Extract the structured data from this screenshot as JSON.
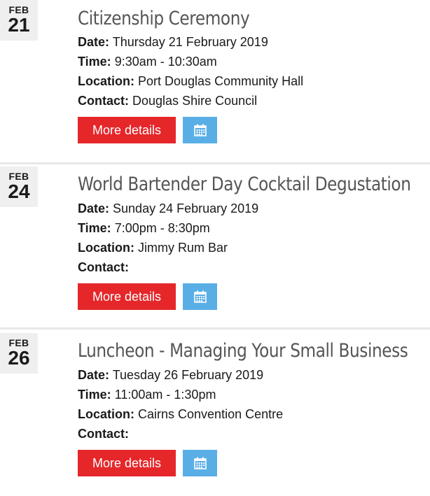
{
  "events": [
    {
      "month": "FEB",
      "day": "21",
      "title": "Citizenship Ceremony",
      "date_label": "Date:",
      "date_value": "Thursday 21 February 2019",
      "time_label": "Time:",
      "time_value": "9:30am - 10:30am",
      "location_label": "Location:",
      "location_value": "Port Douglas Community Hall",
      "contact_label": "Contact:",
      "contact_value": "Douglas Shire Council",
      "button_label": "More details",
      "calendar_icon": "calendar-icon"
    },
    {
      "month": "FEB",
      "day": "24",
      "title": "World Bartender Day Cocktail Degustation",
      "date_label": "Date:",
      "date_value": "Sunday 24 February 2019",
      "time_label": "Time:",
      "time_value": "7:00pm - 8:30pm",
      "location_label": "Location:",
      "location_value": "Jimmy Rum Bar",
      "contact_label": "Contact:",
      "contact_value": "",
      "button_label": "More details",
      "calendar_icon": "calendar-icon"
    },
    {
      "month": "FEB",
      "day": "26",
      "title": "Luncheon - Managing Your Small Business",
      "date_label": "Date:",
      "date_value": "Tuesday 26 February 2019",
      "time_label": "Time:",
      "time_value": "11:00am - 1:30pm",
      "location_label": "Location:",
      "location_value": "Cairns Convention Centre",
      "contact_label": "Contact:",
      "contact_value": "",
      "button_label": "More details",
      "calendar_icon": "calendar-icon"
    }
  ],
  "colors": {
    "button_red": "#e5272a",
    "calendar_blue": "#5aaee6",
    "date_box_bg": "#efefef",
    "title_grey": "#555555"
  }
}
